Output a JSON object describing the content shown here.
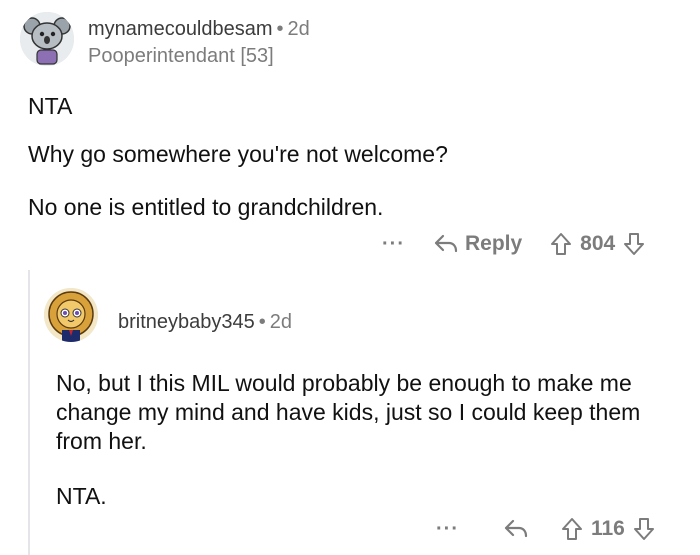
{
  "comments": [
    {
      "username": "mynamecouldbesam",
      "age": "2d",
      "flair": "Pooperintendant [53]",
      "paragraphs": [
        "NTA",
        "Why go somewhere you're not welcome?",
        "No one is entitled to grandchildren."
      ],
      "reply_label": "Reply",
      "vote_count": "804",
      "more_label": "···"
    },
    {
      "username": "britneybaby345",
      "age": "2d",
      "paragraphs": [
        "No, but I this MIL would probably be enough to make me change my mind and have kids, just so I could keep them from her.",
        "NTA."
      ],
      "vote_count": "116",
      "more_label": "···"
    }
  ],
  "separator": "•",
  "icons": {
    "avatar1": "koala-avatar",
    "avatar2": "lion-avatar",
    "reply": "reply-arrow-icon",
    "upvote": "upvote-icon",
    "downvote": "downvote-icon"
  },
  "colors": {
    "text": "#1a1a1b",
    "meta": "#7c7c7c",
    "thread_line": "#e3e5e8"
  }
}
